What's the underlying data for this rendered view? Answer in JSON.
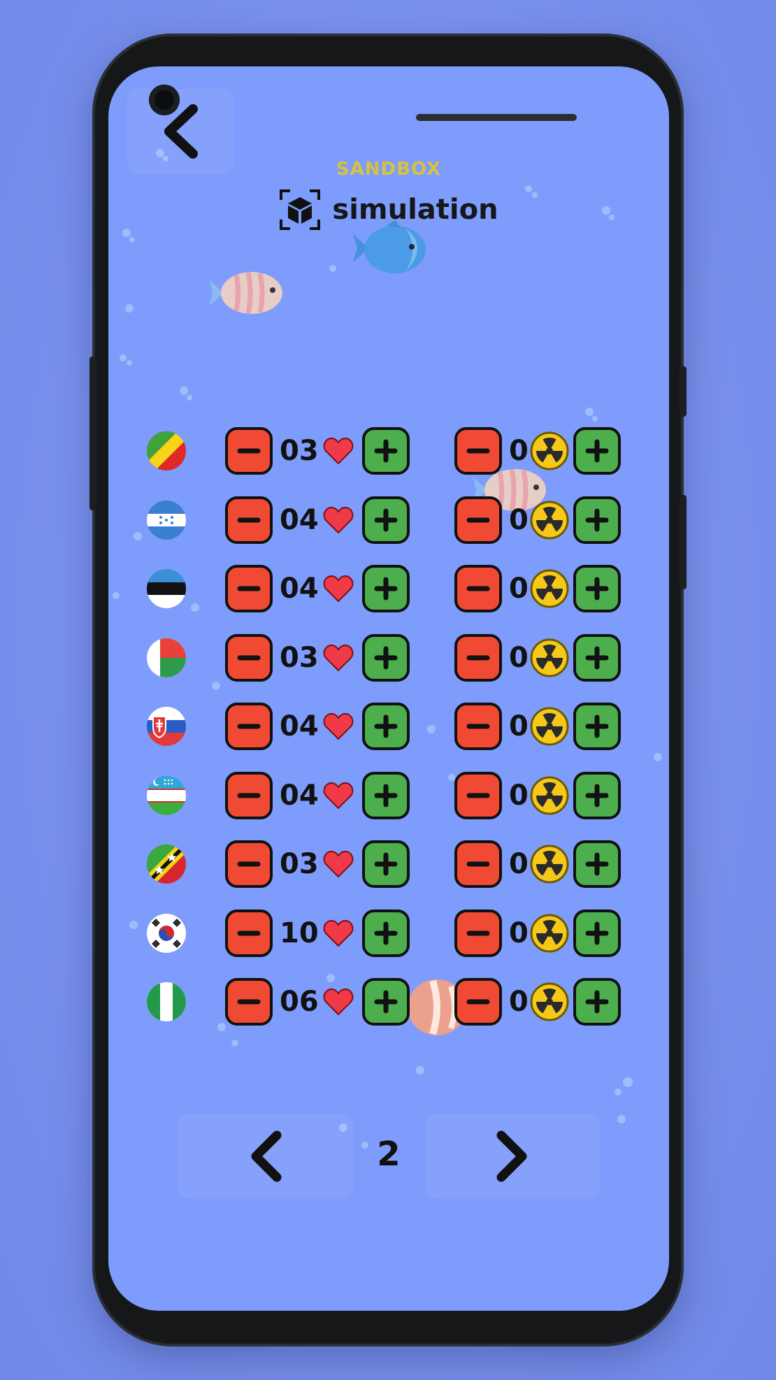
{
  "header": {
    "mode_label": "SANDBOX",
    "title": "simulation",
    "back_icon": "chevron-left-icon",
    "title_icon": "cube-scan-icon"
  },
  "colors": {
    "minus_button": "#f14a34",
    "plus_button": "#4cae4c",
    "screen_background": "#7e9cfb",
    "mode_label": "#d8c23c"
  },
  "countries": [
    {
      "flag": "republic-of-the-congo-flag",
      "lives": "03",
      "nukes": "0"
    },
    {
      "flag": "honduras-flag",
      "lives": "04",
      "nukes": "0"
    },
    {
      "flag": "estonia-flag",
      "lives": "04",
      "nukes": "0"
    },
    {
      "flag": "madagascar-flag",
      "lives": "03",
      "nukes": "0"
    },
    {
      "flag": "slovakia-flag",
      "lives": "04",
      "nukes": "0"
    },
    {
      "flag": "uzbekistan-flag",
      "lives": "04",
      "nukes": "0"
    },
    {
      "flag": "saint-kitts-and-nevis-flag",
      "lives": "03",
      "nukes": "0"
    },
    {
      "flag": "south-korea-flag",
      "lives": "10",
      "nukes": "0"
    },
    {
      "flag": "nigeria-flag",
      "lives": "06",
      "nukes": "0"
    }
  ],
  "pagination": {
    "page": "2",
    "prev_icon": "chevron-left-icon",
    "next_icon": "chevron-right-icon"
  }
}
